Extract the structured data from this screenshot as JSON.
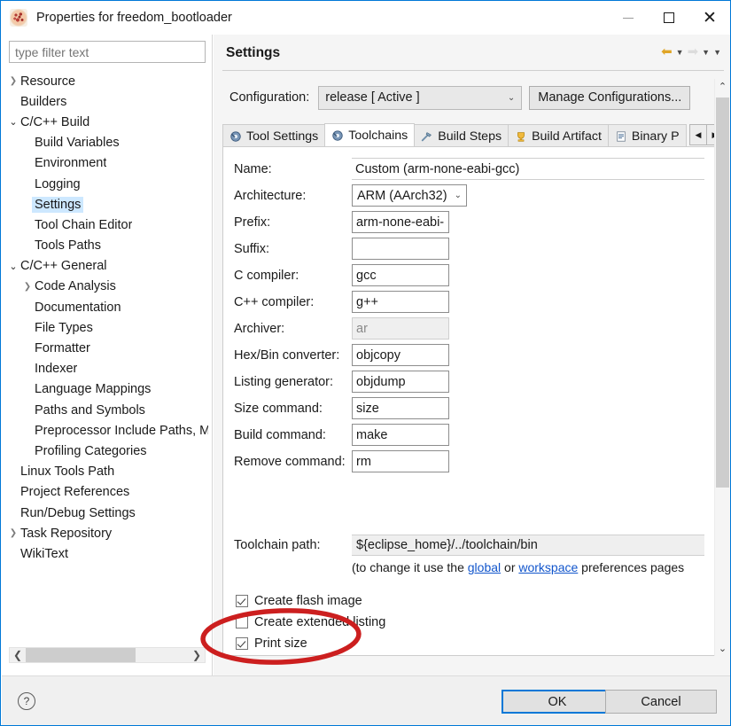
{
  "window": {
    "title": "Properties for freedom_bootloader",
    "icon": "project-icon",
    "controls": {
      "minimize": "minimize-icon",
      "maximize": "maximize-icon",
      "close": "close-icon"
    }
  },
  "sidebar": {
    "filter": {
      "placeholder": "type filter text",
      "value": ""
    },
    "items": [
      {
        "label": "Resource",
        "level": 0,
        "twisty": "collapsed",
        "selected": false
      },
      {
        "label": "Builders",
        "level": 0,
        "twisty": "none",
        "selected": false
      },
      {
        "label": "C/C++ Build",
        "level": 0,
        "twisty": "expanded",
        "selected": false
      },
      {
        "label": "Build Variables",
        "level": 1,
        "twisty": "none",
        "selected": false
      },
      {
        "label": "Environment",
        "level": 1,
        "twisty": "none",
        "selected": false
      },
      {
        "label": "Logging",
        "level": 1,
        "twisty": "none",
        "selected": false
      },
      {
        "label": "Settings",
        "level": 1,
        "twisty": "none",
        "selected": true
      },
      {
        "label": "Tool Chain Editor",
        "level": 1,
        "twisty": "none",
        "selected": false
      },
      {
        "label": "Tools Paths",
        "level": 1,
        "twisty": "none",
        "selected": false
      },
      {
        "label": "C/C++ General",
        "level": 0,
        "twisty": "expanded",
        "selected": false
      },
      {
        "label": "Code Analysis",
        "level": 1,
        "twisty": "collapsed",
        "selected": false
      },
      {
        "label": "Documentation",
        "level": 1,
        "twisty": "none",
        "selected": false
      },
      {
        "label": "File Types",
        "level": 1,
        "twisty": "none",
        "selected": false
      },
      {
        "label": "Formatter",
        "level": 1,
        "twisty": "none",
        "selected": false
      },
      {
        "label": "Indexer",
        "level": 1,
        "twisty": "none",
        "selected": false
      },
      {
        "label": "Language Mappings",
        "level": 1,
        "twisty": "none",
        "selected": false
      },
      {
        "label": "Paths and Symbols",
        "level": 1,
        "twisty": "none",
        "selected": false
      },
      {
        "label": "Preprocessor Include Paths, M",
        "level": 1,
        "twisty": "none",
        "selected": false
      },
      {
        "label": "Profiling Categories",
        "level": 1,
        "twisty": "none",
        "selected": false
      },
      {
        "label": "Linux Tools Path",
        "level": 0,
        "twisty": "none",
        "selected": false
      },
      {
        "label": "Project References",
        "level": 0,
        "twisty": "none",
        "selected": false
      },
      {
        "label": "Run/Debug Settings",
        "level": 0,
        "twisty": "none",
        "selected": false
      },
      {
        "label": "Task Repository",
        "level": 0,
        "twisty": "collapsed",
        "selected": false
      },
      {
        "label": "WikiText",
        "level": 0,
        "twisty": "none",
        "selected": false
      }
    ],
    "hscroll": {
      "left_arrow": "chevron-left-icon",
      "right_arrow": "chevron-right-icon"
    }
  },
  "page": {
    "title": "Settings",
    "nav": {
      "back": "back-arrow-icon",
      "back_menu": "chevron-down-icon",
      "forward": "forward-arrow-icon",
      "forward_menu": "chevron-down-icon",
      "more": "chevron-down-icon"
    },
    "configuration": {
      "label": "Configuration:",
      "selected": "release  [ Active ]",
      "manage_button": "Manage Configurations..."
    },
    "tabs": [
      {
        "label": "Tool Settings",
        "icon": "wrench-gear-icon",
        "active": false
      },
      {
        "label": "Toolchains",
        "icon": "wrench-gear-icon",
        "active": true
      },
      {
        "label": "Build Steps",
        "icon": "hammer-icon",
        "active": false
      },
      {
        "label": "Build Artifact",
        "icon": "trophy-icon",
        "active": false
      },
      {
        "label": "Binary P",
        "icon": "document-icon",
        "active": false
      }
    ],
    "tab_scroll": {
      "left": "triangle-left-icon",
      "right": "triangle-right-icon"
    },
    "form": [
      {
        "label": "Name:",
        "value": "Custom (arm-none-eabi-gcc)",
        "type": "text-wide",
        "readonly": false
      },
      {
        "label": "Architecture:",
        "value": "ARM (AArch32)",
        "type": "combo",
        "readonly": false
      },
      {
        "label": "Prefix:",
        "value": "arm-none-eabi-",
        "type": "text",
        "readonly": false
      },
      {
        "label": "Suffix:",
        "value": "",
        "type": "text",
        "readonly": false
      },
      {
        "label": "C compiler:",
        "value": "gcc",
        "type": "text",
        "readonly": false
      },
      {
        "label": "C++ compiler:",
        "value": "g++",
        "type": "text",
        "readonly": false
      },
      {
        "label": "Archiver:",
        "value": "ar",
        "type": "text",
        "readonly": true
      },
      {
        "label": "Hex/Bin converter:",
        "value": "objcopy",
        "type": "text",
        "readonly": false
      },
      {
        "label": "Listing generator:",
        "value": "objdump",
        "type": "text",
        "readonly": false
      },
      {
        "label": "Size command:",
        "value": "size",
        "type": "text",
        "readonly": false
      },
      {
        "label": "Build command:",
        "value": "make",
        "type": "text",
        "readonly": false
      },
      {
        "label": "Remove command:",
        "value": "rm",
        "type": "text",
        "readonly": false
      }
    ],
    "toolchain_path": {
      "label": "Toolchain path:",
      "value": "${eclipse_home}/../toolchain/bin"
    },
    "hint": {
      "prefix": "(to change it use the ",
      "link1": "global",
      "middle": " or ",
      "link2": "workspace",
      "suffix": " preferences pages"
    },
    "checkboxes": [
      {
        "label": "Create flash image",
        "checked": true
      },
      {
        "label": "Create extended listing",
        "checked": false
      },
      {
        "label": "Print size",
        "checked": true
      }
    ],
    "scrollbar": {
      "up": "chevron-up-icon",
      "down": "chevron-down-icon"
    }
  },
  "footer": {
    "help": "help-icon",
    "ok": "OK",
    "cancel": "Cancel"
  },
  "annotation": {
    "type": "red-ellipse",
    "color": "#cc1f1f",
    "encircles": "Create extended listing / Print size checkboxes"
  }
}
